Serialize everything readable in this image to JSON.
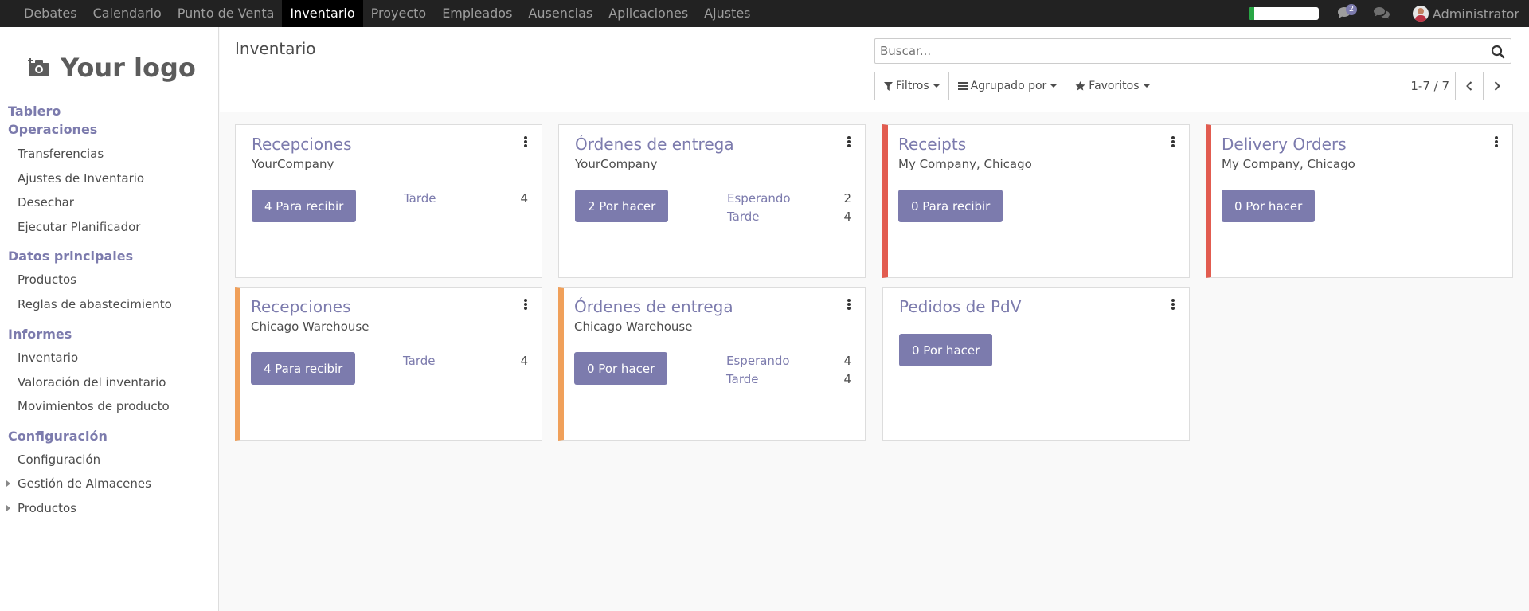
{
  "topbar": {
    "menu": [
      "Debates",
      "Calendario",
      "Punto de Venta",
      "Inventario",
      "Proyecto",
      "Empleados",
      "Ausencias",
      "Aplicaciones",
      "Ajustes"
    ],
    "active_index": 3,
    "progress_fraction": 0.08,
    "chat_badge": "2",
    "user_name": "Administrator"
  },
  "sidebar": {
    "logo_text": "Your logo",
    "sections": [
      {
        "label": "Tablero",
        "items": []
      },
      {
        "label": "Operaciones",
        "items": [
          "Transferencias",
          "Ajustes de Inventario",
          "Desechar",
          "Ejecutar Planificador"
        ]
      },
      {
        "label": "Datos principales",
        "items": [
          "Productos",
          "Reglas de abastecimiento"
        ]
      },
      {
        "label": "Informes",
        "items": [
          "Inventario",
          "Valoración del inventario",
          "Movimientos de producto"
        ]
      },
      {
        "label": "Configuración",
        "items": [
          "Configuración",
          "Gestión de Almacenes",
          "Productos"
        ]
      }
    ]
  },
  "control_panel": {
    "title": "Inventario",
    "search_placeholder": "Buscar...",
    "filters_label": "Filtros",
    "groupby_label": "Agrupado por",
    "favorites_label": "Favoritos",
    "pager": "1-7 / 7"
  },
  "cards": [
    {
      "title": "Recepciones",
      "company": "YourCompany",
      "action": "4 Para recibir",
      "stats": [
        {
          "label": "Tarde",
          "value": "4"
        }
      ]
    },
    {
      "title": "Órdenes de entrega",
      "company": "YourCompany",
      "action": "2 Por hacer",
      "stats": [
        {
          "label": "Esperando",
          "value": "2"
        },
        {
          "label": "Tarde",
          "value": "4"
        }
      ]
    },
    {
      "title": "Receipts",
      "company": "My Company, Chicago",
      "action": "0 Para recibir",
      "stats": []
    },
    {
      "title": "Delivery Orders",
      "company": "My Company, Chicago",
      "action": "0 Por hacer",
      "stats": []
    },
    {
      "title": "Recepciones",
      "company": "Chicago Warehouse",
      "action": "4 Para recibir",
      "stats": [
        {
          "label": "Tarde",
          "value": "4"
        }
      ]
    },
    {
      "title": "Órdenes de entrega",
      "company": "Chicago Warehouse",
      "action": "0 Por hacer",
      "stats": [
        {
          "label": "Esperando",
          "value": "4"
        },
        {
          "label": "Tarde",
          "value": "4"
        }
      ]
    },
    {
      "title": "Pedidos de PdV",
      "company": "",
      "action": "0 Por hacer",
      "stats": []
    }
  ],
  "colors": {
    "accent": "#7c7bad",
    "warning": "#f0a05a",
    "danger": "#e25c50",
    "topbar": "#222222"
  }
}
